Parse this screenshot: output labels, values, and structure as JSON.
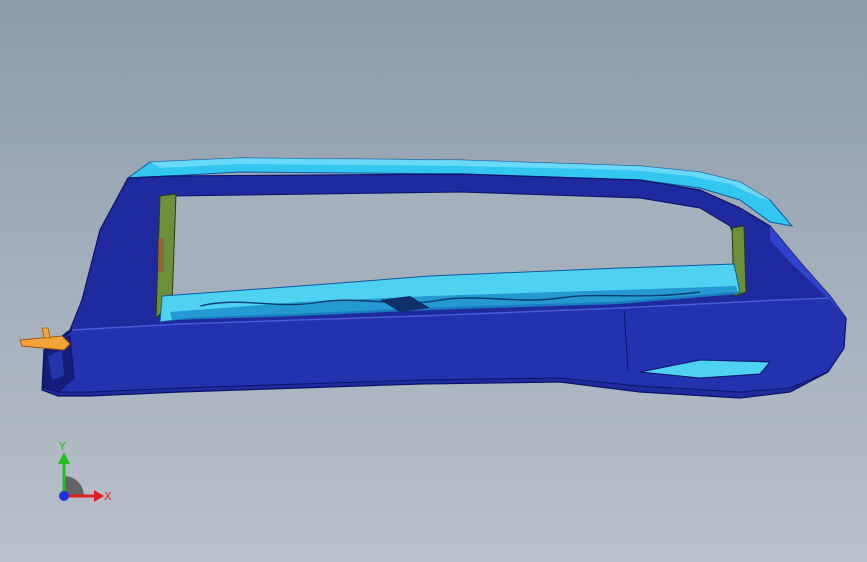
{
  "viewport": {
    "background_top": "#8d9bab",
    "background_bottom": "#b9c1ca"
  },
  "model": {
    "body_color": "#1f2a9e",
    "body_dark": "#141d7a",
    "rail_light": "#2aa7e8",
    "rail_cyan": "#33c6f0",
    "inner_cyan": "#4fd2f2",
    "insert_green": "#6e8f3a",
    "tab_orange": "#f2a33a"
  },
  "triad": {
    "x_label": "X",
    "y_label": "Y",
    "x_color": "#e02020",
    "y_color": "#20c020",
    "z_color": "#2030e0"
  }
}
